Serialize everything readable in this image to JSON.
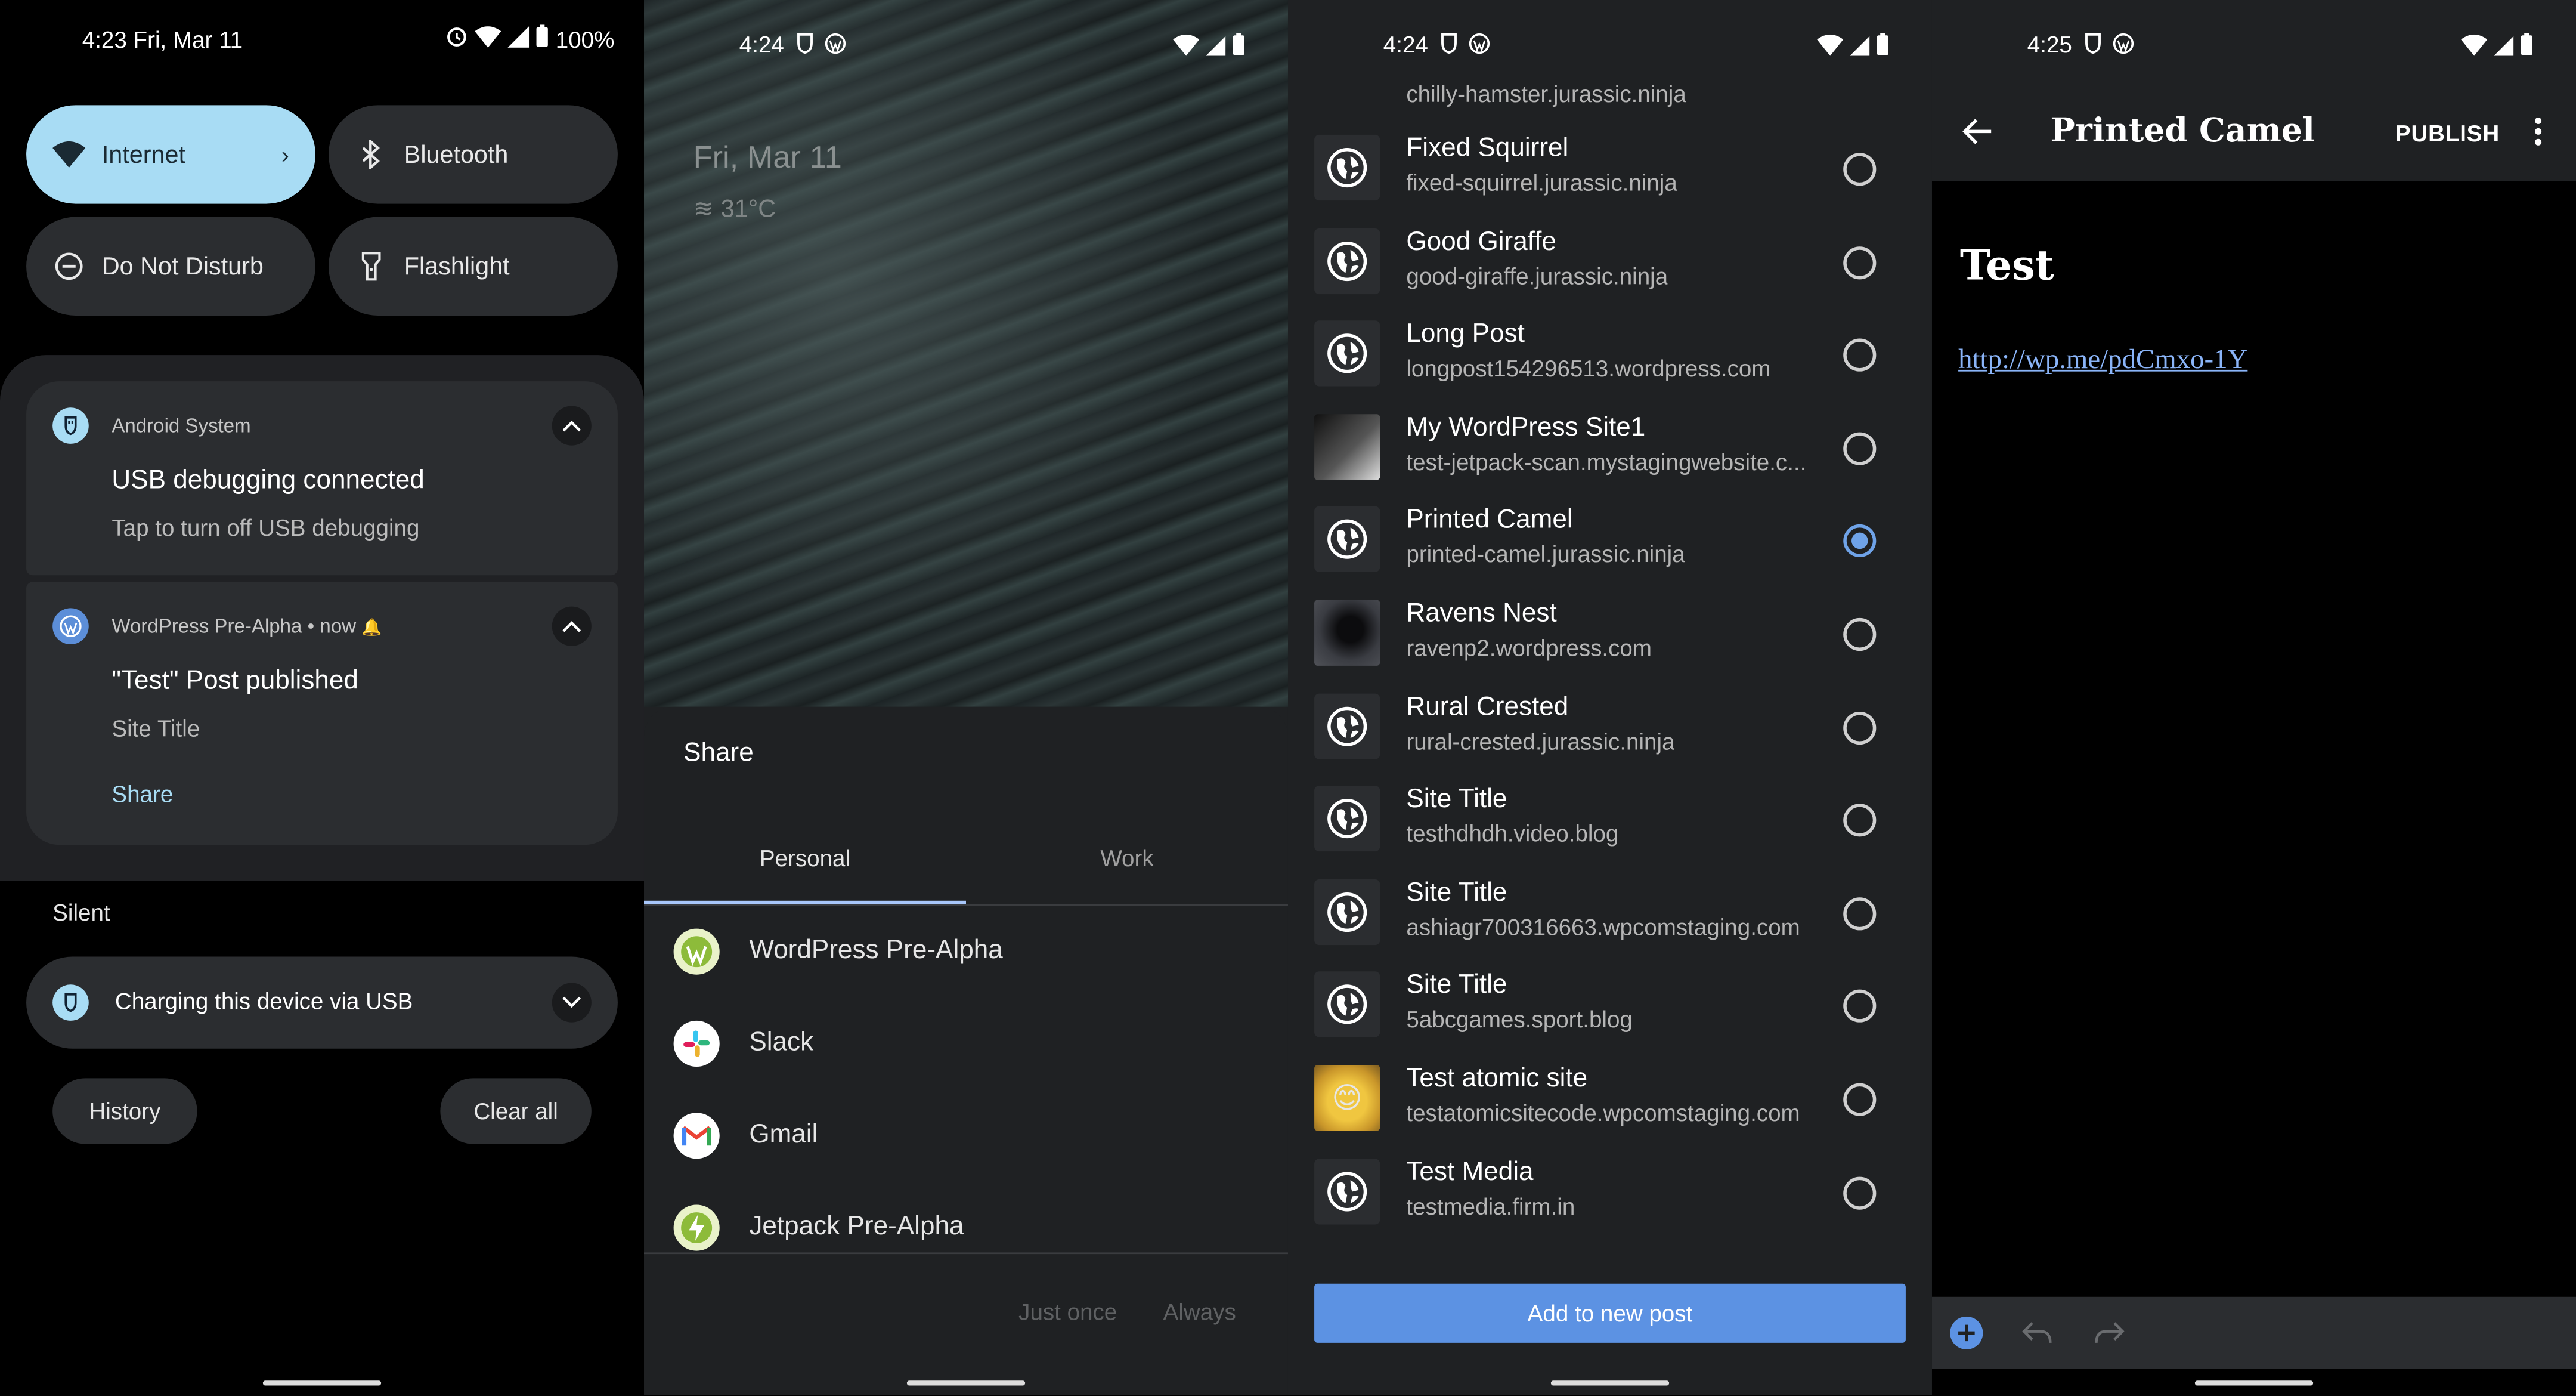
{
  "colors": {
    "accent_blue": "#5c92e3",
    "tile_active": "#a8dcf4",
    "surface": "#2b2d30",
    "panel_bg": "#1f2123",
    "link": "#8ab4f8",
    "background": "#000000"
  },
  "panel1": {
    "status": {
      "time": "4:23 Fri, Mar 11",
      "battery": "100%",
      "icons": [
        "alarm-icon",
        "wifi-icon",
        "signal-icon",
        "battery-icon"
      ]
    },
    "tiles": [
      {
        "label": "Internet",
        "icon": "wifi-icon",
        "active": true,
        "chevron": "›"
      },
      {
        "label": "Bluetooth",
        "icon": "bluetooth-icon",
        "active": false
      },
      {
        "label": "Do Not Disturb",
        "icon": "do-not-disturb-icon",
        "active": false
      },
      {
        "label": "Flashlight",
        "icon": "flashlight-icon",
        "active": false
      }
    ],
    "notifications": [
      {
        "app": "Android System",
        "title": "USB debugging connected",
        "text": "Tap to turn off USB debugging",
        "icon": "usb-icon"
      },
      {
        "app": "WordPress Pre-Alpha",
        "time": "now",
        "title": "\"Test\" Post published",
        "text": "Site Title",
        "action": "Share",
        "icon": "wordpress-icon"
      }
    ],
    "section_label": "Silent",
    "silent_notification": {
      "title": "Charging this device via USB",
      "icon": "usb-icon"
    },
    "buttons": {
      "history": "History",
      "clear_all": "Clear all"
    }
  },
  "panel2": {
    "status": {
      "time": "4:24"
    },
    "lock": {
      "date": "Fri, Mar 11",
      "weather": "31°C"
    },
    "share": {
      "title": "Share",
      "tabs": [
        "Personal",
        "Work"
      ],
      "apps": [
        {
          "label": "WordPress Pre-Alpha",
          "icon": "wordpress-icon"
        },
        {
          "label": "Slack",
          "icon": "slack-icon"
        },
        {
          "label": "Gmail",
          "icon": "gmail-icon"
        },
        {
          "label": "Jetpack Pre-Alpha",
          "icon": "jetpack-icon"
        }
      ],
      "just_once": "Just once",
      "always": "Always"
    }
  },
  "panel3": {
    "status": {
      "time": "4:24"
    },
    "partial_site": {
      "url": "chilly-hamster.jurassic.ninja"
    },
    "sites": [
      {
        "name": "Fixed Squirrel",
        "url": "fixed-squirrel.jurassic.ninja",
        "icon": "globe-icon",
        "selected": false
      },
      {
        "name": "Good Giraffe",
        "url": "good-giraffe.jurassic.ninja",
        "icon": "globe-icon",
        "selected": false
      },
      {
        "name": "Long Post",
        "url": "longpost154296513.wordpress.com",
        "icon": "globe-icon",
        "selected": false
      },
      {
        "name": "My WordPress Site1",
        "url": "test-jetpack-scan.mystagingwebsite.c...",
        "icon": "site-image-icon",
        "selected": false
      },
      {
        "name": "Printed Camel",
        "url": "printed-camel.jurassic.ninja",
        "icon": "globe-icon",
        "selected": true
      },
      {
        "name": "Ravens Nest",
        "url": "ravenp2.wordpress.com",
        "icon": "raven-image-icon",
        "selected": false
      },
      {
        "name": "Rural Crested",
        "url": "rural-crested.jurassic.ninja",
        "icon": "globe-icon",
        "selected": false
      },
      {
        "name": "Site Title",
        "url": "testhdhdh.video.blog",
        "icon": "globe-icon",
        "selected": false
      },
      {
        "name": "Site Title",
        "url": "ashiagr700316663.wpcomstaging.com",
        "icon": "globe-icon",
        "selected": false
      },
      {
        "name": "Site Title",
        "url": "5abcgames.sport.blog",
        "icon": "globe-icon",
        "selected": false
      },
      {
        "name": "Test atomic site",
        "url": "testatomicsitecode.wpcomstaging.com",
        "icon": "emoji-image-icon",
        "selected": false
      },
      {
        "name": "Test Media",
        "url": "testmedia.firm.in",
        "icon": "globe-icon",
        "selected": false
      }
    ],
    "add_button": "Add to new post"
  },
  "panel4": {
    "status": {
      "time": "4:25"
    },
    "appbar": {
      "title": "Printed Camel",
      "publish": "PUBLISH"
    },
    "post": {
      "title": "Test",
      "link": "http://wp.me/pdCmxo-1Y"
    }
  }
}
